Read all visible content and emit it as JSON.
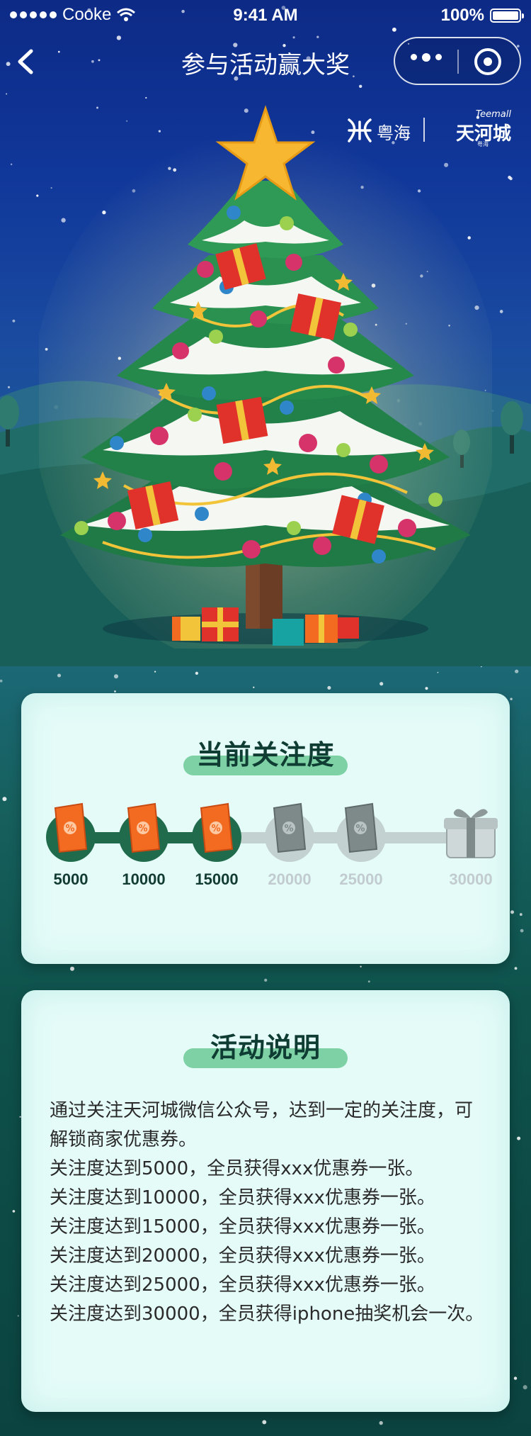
{
  "status_bar": {
    "carrier": "Cooke",
    "time": "9:41 AM",
    "battery": "100%"
  },
  "nav": {
    "title": "参与活动赢大奖"
  },
  "logo": {
    "brand1": "粤海",
    "brand2": "天河城",
    "brand_en": "Teemall",
    "brand_sub": "粤海"
  },
  "attention_card": {
    "heading": "当前关注度",
    "milestones": [
      {
        "value": "5000",
        "status": "unlocked",
        "icon": "coupon-icon"
      },
      {
        "value": "10000",
        "status": "unlocked",
        "icon": "coupon-icon"
      },
      {
        "value": "15000",
        "status": "unlocked",
        "icon": "coupon-icon"
      },
      {
        "value": "20000",
        "status": "locked",
        "icon": "coupon-icon"
      },
      {
        "value": "25000",
        "status": "locked",
        "icon": "coupon-icon"
      },
      {
        "value": "30000",
        "status": "locked",
        "icon": "gift-icon"
      }
    ]
  },
  "rules_card": {
    "heading": "活动说明",
    "lines": [
      "通过关注天河城微信公众号，达到一定的关注度，可解锁商家优惠券。",
      "关注度达到5000，全员获得xxx优惠券一张。",
      "关注度达到10000，全员获得xxx优惠券一张。",
      "关注度达到15000，全员获得xxx优惠券一张。",
      "关注度达到20000，全员获得xxx优惠券一张。",
      "关注度达到25000，全员获得xxx优惠券一张。",
      "关注度达到30000，全员获得iphone抽奖机会一次。"
    ]
  },
  "colors": {
    "sky_top": "#0d2a86",
    "sky_bottom": "#0b4340",
    "card_bg": "#e4fbf8",
    "pill": "#7dd1a4",
    "coupon_orange": "#f26b21",
    "progress_done": "#1f6b4b",
    "progress_todo": "#c3d1d0"
  }
}
